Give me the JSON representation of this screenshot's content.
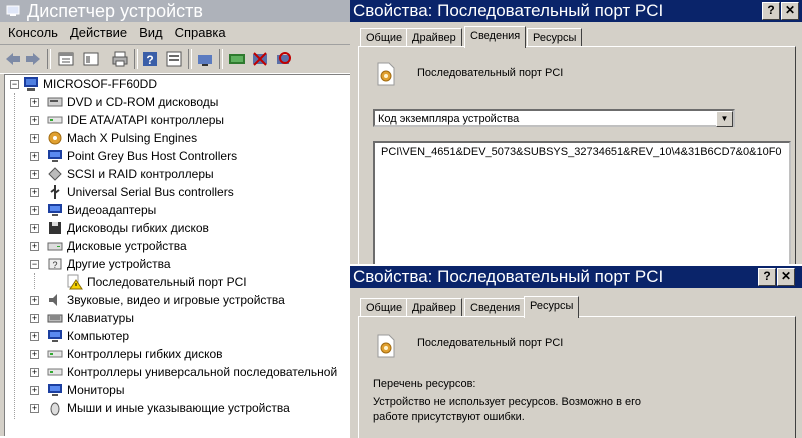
{
  "device_manager": {
    "title": "Диспетчер устройств",
    "menu": [
      "Консоль",
      "Действие",
      "Вид",
      "Справка"
    ],
    "toolbar_icons": [
      "back-icon",
      "forward-icon",
      "properties-icon",
      "view-icon",
      "print-icon",
      "help-icon",
      "list-icon",
      "scan-hardware-icon",
      "disable-device-icon",
      "uninstall-device-icon"
    ],
    "root": "MICROSOF-FF60DD",
    "items": [
      {
        "label": "DVD и CD-ROM дисководы",
        "icon": "cdrom-icon",
        "expander": "+"
      },
      {
        "label": "IDE ATA/ATAPI контроллеры",
        "icon": "ide-controller-icon",
        "expander": "+"
      },
      {
        "label": "Mach  X Pulsing Engines",
        "icon": "engine-icon",
        "expander": "+"
      },
      {
        "label": "Point Grey Bus Host Controllers",
        "icon": "monitor-icon",
        "expander": "+"
      },
      {
        "label": "SCSI и RAID контроллеры",
        "icon": "scsi-icon",
        "expander": "+"
      },
      {
        "label": "Universal Serial Bus controllers",
        "icon": "usb-icon",
        "expander": "+"
      },
      {
        "label": "Видеоадаптеры",
        "icon": "display-adapter-icon",
        "expander": "+"
      },
      {
        "label": "Дисководы гибких дисков",
        "icon": "floppy-icon",
        "expander": "+"
      },
      {
        "label": "Дисковые устройства",
        "icon": "disk-drive-icon",
        "expander": "+"
      },
      {
        "label": "Другие устройства",
        "icon": "unknown-device-icon",
        "expander": "−"
      },
      {
        "label": "Последовательный порт PCI",
        "icon": "warning-device-icon",
        "expander": "",
        "child": true
      },
      {
        "label": "Звуковые, видео и игровые устройства",
        "icon": "sound-icon",
        "expander": "+"
      },
      {
        "label": "Клавиатуры",
        "icon": "keyboard-icon",
        "expander": "+"
      },
      {
        "label": "Компьютер",
        "icon": "computer-icon",
        "expander": "+"
      },
      {
        "label": "Контроллеры гибких дисков",
        "icon": "floppy-controller-icon",
        "expander": "+"
      },
      {
        "label": "Контроллеры универсальной последовательной",
        "icon": "usb-controller-icon",
        "expander": "+"
      },
      {
        "label": "Мониторы",
        "icon": "monitor-icon",
        "expander": "+"
      },
      {
        "label": "Мыши и иные указывающие устройства",
        "icon": "mouse-icon",
        "expander": "+"
      }
    ]
  },
  "dialog_details": {
    "title": "Свойства: Последовательный порт PCI",
    "buttons": [
      "?",
      "✕"
    ],
    "tabs": [
      "Общие",
      "Драйвер",
      "Сведения",
      "Ресурсы"
    ],
    "selected_tab": "Сведения",
    "device_name": "Последовательный порт PCI",
    "property_select": "Код экземпляра устройства",
    "property_value": "PCI\\VEN_4651&DEV_5073&SUBSYS_32734651&REV_10\\4&31B6CD7&0&10F0"
  },
  "dialog_resources": {
    "title": "Свойства: Последовательный порт PCI",
    "buttons": [
      "?",
      "✕"
    ],
    "tabs": [
      "Общие",
      "Драйвер",
      "Сведения",
      "Ресурсы"
    ],
    "selected_tab": "Ресурсы",
    "device_name": "Последовательный порт PCI",
    "resource_header": "Перечень ресурсов:",
    "resource_note": "Устройство не использует ресурсов. Возможно в его работе присутствуют ошибки."
  }
}
